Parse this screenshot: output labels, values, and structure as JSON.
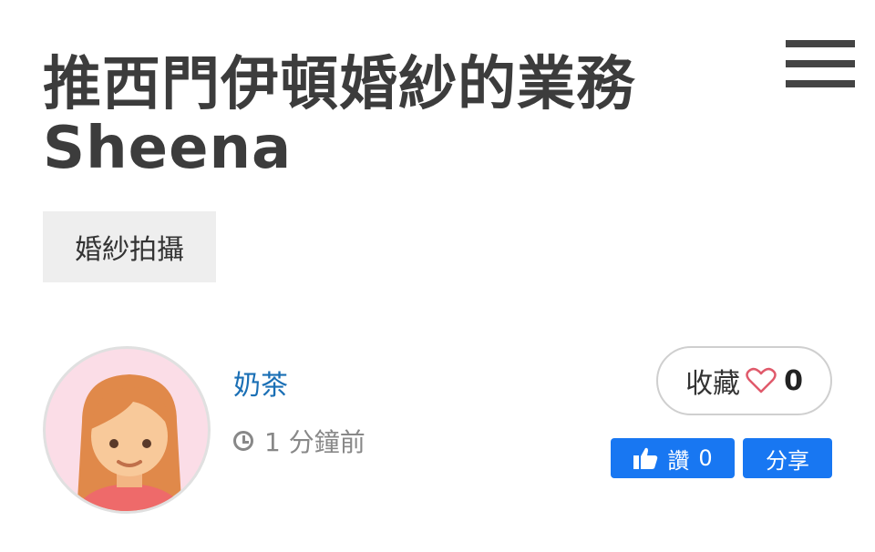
{
  "post": {
    "title": "推西門伊頓婚紗的業務Sheena",
    "tag": "婚紗拍攝"
  },
  "author": {
    "name": "奶茶",
    "time_ago": "1 分鐘前"
  },
  "favorite": {
    "label": "收藏",
    "count": "0"
  },
  "facebook": {
    "like_label": "讚",
    "like_count": "0",
    "share_label": "分享"
  },
  "colors": {
    "link": "#1a6fb5",
    "facebook_blue": "#1877f2",
    "heart": "#e05a6b"
  }
}
